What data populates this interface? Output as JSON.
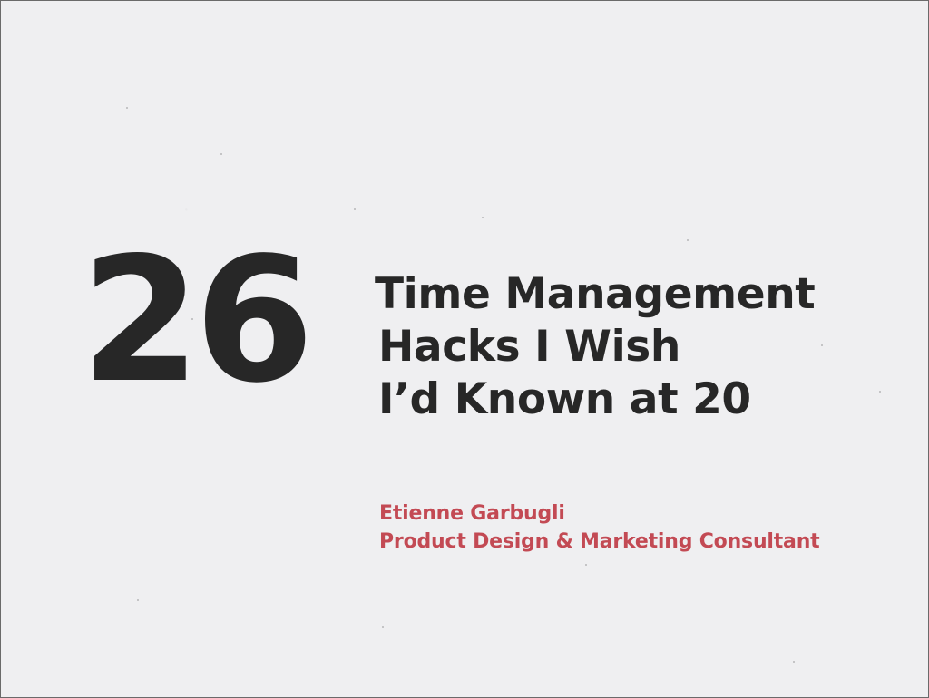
{
  "slide": {
    "number": "26",
    "title_lines": [
      "Time Management",
      "Hacks I Wish",
      "I’d Known at 20"
    ],
    "author": {
      "name": "Etienne Garbugli",
      "role": "Product Design & Marketing Consultant"
    }
  },
  "colors": {
    "background": "#efeff1",
    "text_dark": "#272727",
    "accent": "#c34a54"
  }
}
